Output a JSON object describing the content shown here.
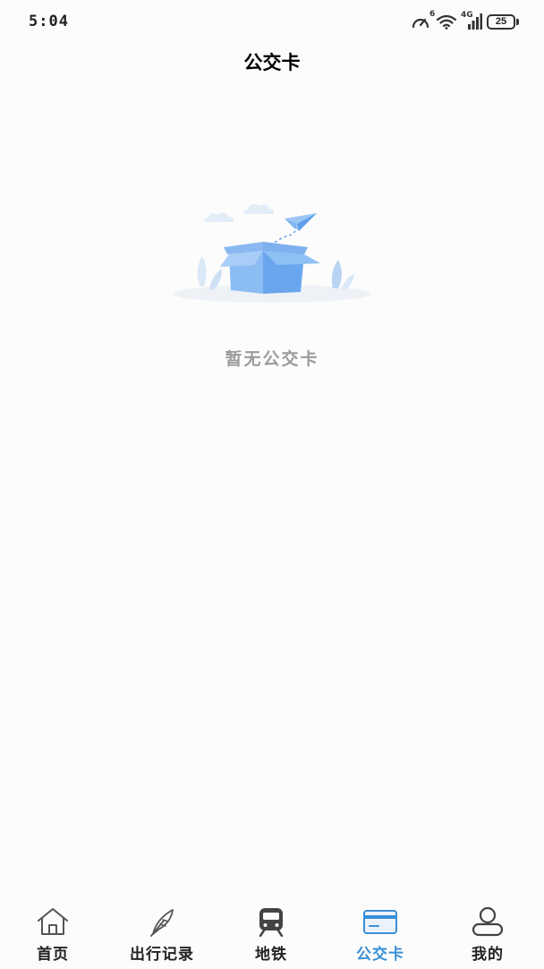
{
  "status_bar": {
    "time": "5:04",
    "network_label": "4G",
    "wifi_label": "6",
    "battery": "25"
  },
  "header": {
    "title": "公交卡"
  },
  "empty_state": {
    "message": "暂无公交卡",
    "illustration": "empty-box-paper-plane"
  },
  "tab_bar": {
    "active_color": "#3a8fd6",
    "items": [
      {
        "label": "首页",
        "icon": "home-icon"
      },
      {
        "label": "出行记录",
        "icon": "feather-icon"
      },
      {
        "label": "地铁",
        "icon": "train-icon"
      },
      {
        "label": "公交卡",
        "icon": "card-icon",
        "active": true
      },
      {
        "label": "我的",
        "icon": "user-icon"
      }
    ]
  }
}
